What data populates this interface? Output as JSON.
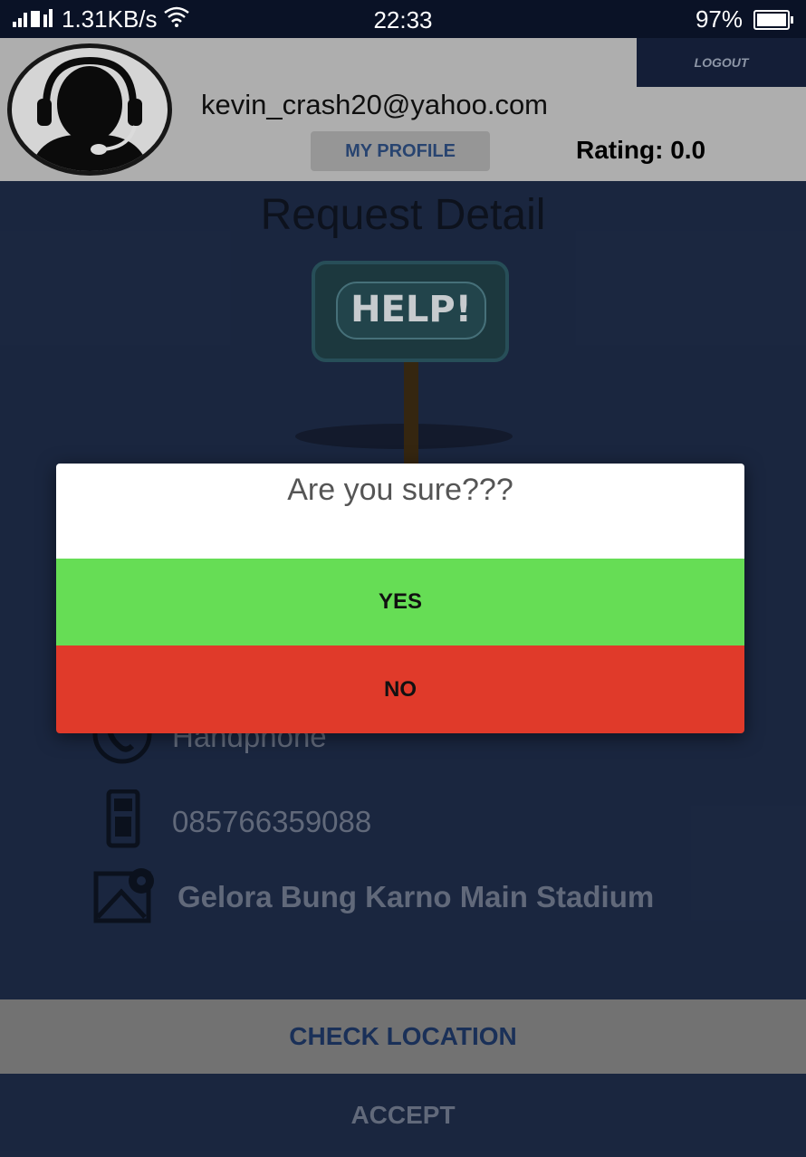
{
  "status_bar": {
    "network": "1.31KB/s",
    "time": "22:33",
    "battery": "97%"
  },
  "header": {
    "email": "kevin_crash20@yahoo.com",
    "profile_button": "MY PROFILE",
    "rating": "Rating: 0.0",
    "logout": "LOGOUT"
  },
  "content": {
    "title": "Request Detail",
    "help_sign_text": "HELP!",
    "phone_type": "Handphone",
    "phone_number": "085766359088",
    "location": "Gelora Bung Karno Main Stadium"
  },
  "dialog": {
    "message": "Are you sure???",
    "yes": "YES",
    "no": "NO"
  },
  "bottom": {
    "check_location": "CHECK LOCATION",
    "accept": "ACCEPT"
  },
  "colors": {
    "header_bg": "#bdbdbd",
    "main_bg": "#1d2a45",
    "yes": "#66dd55",
    "no": "#e03a2a"
  }
}
